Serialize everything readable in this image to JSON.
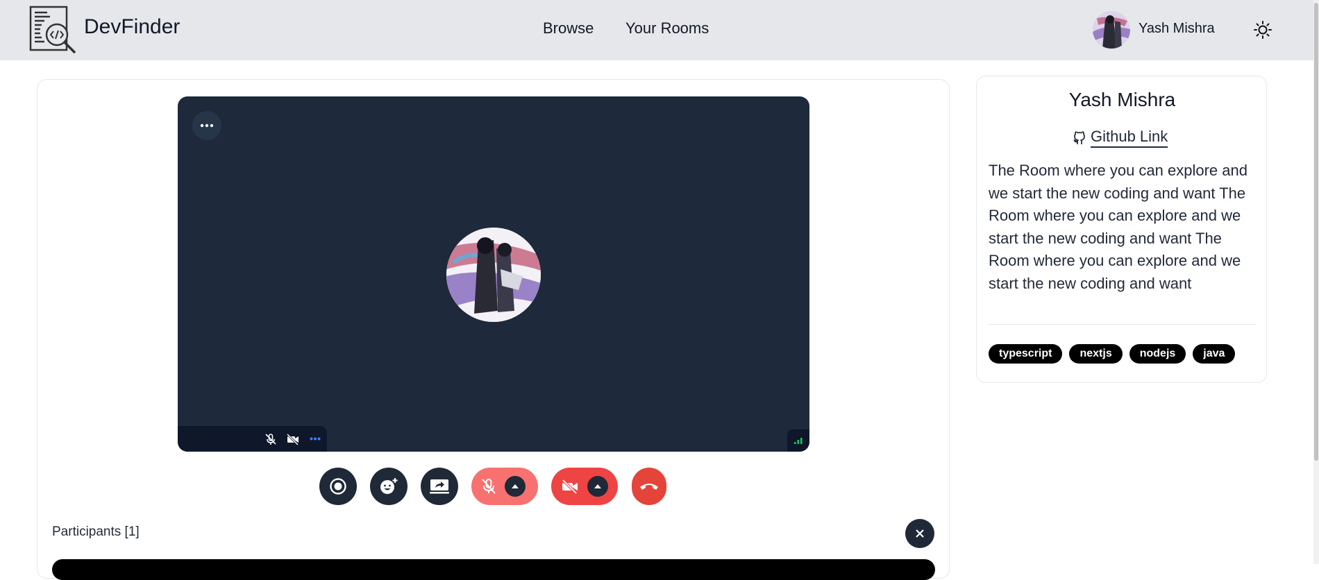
{
  "header": {
    "brand": "DevFinder",
    "nav": [
      {
        "label": "Browse"
      },
      {
        "label": "Your Rooms"
      }
    ],
    "user_name": "Yash Mishra"
  },
  "call": {
    "participant_name": "Yash Mishra",
    "participants_label": "Participants [1]"
  },
  "room": {
    "owner": "Yash Mishra",
    "github_label": "Github Link",
    "description": "The Room where you can explore and we start the new coding and want The Room where you can explore and we start the new coding and want The Room where you can explore and we start the new coding and want",
    "tags": [
      "typescript",
      "nextjs",
      "nodejs",
      "java"
    ]
  },
  "colors": {
    "header_bg": "#e5e7eb",
    "video_bg": "#1e293b",
    "danger": "#ef4444",
    "danger_light": "#f87171",
    "control_dark": "#1f2937"
  },
  "icons": [
    "logo-icon",
    "sun-icon",
    "more-icon",
    "mic-off-icon",
    "video-off-icon",
    "signal-icon",
    "record-icon",
    "emoji-icon",
    "screen-share-icon",
    "caret-up-icon",
    "hang-up-icon",
    "close-icon",
    "github-icon"
  ]
}
